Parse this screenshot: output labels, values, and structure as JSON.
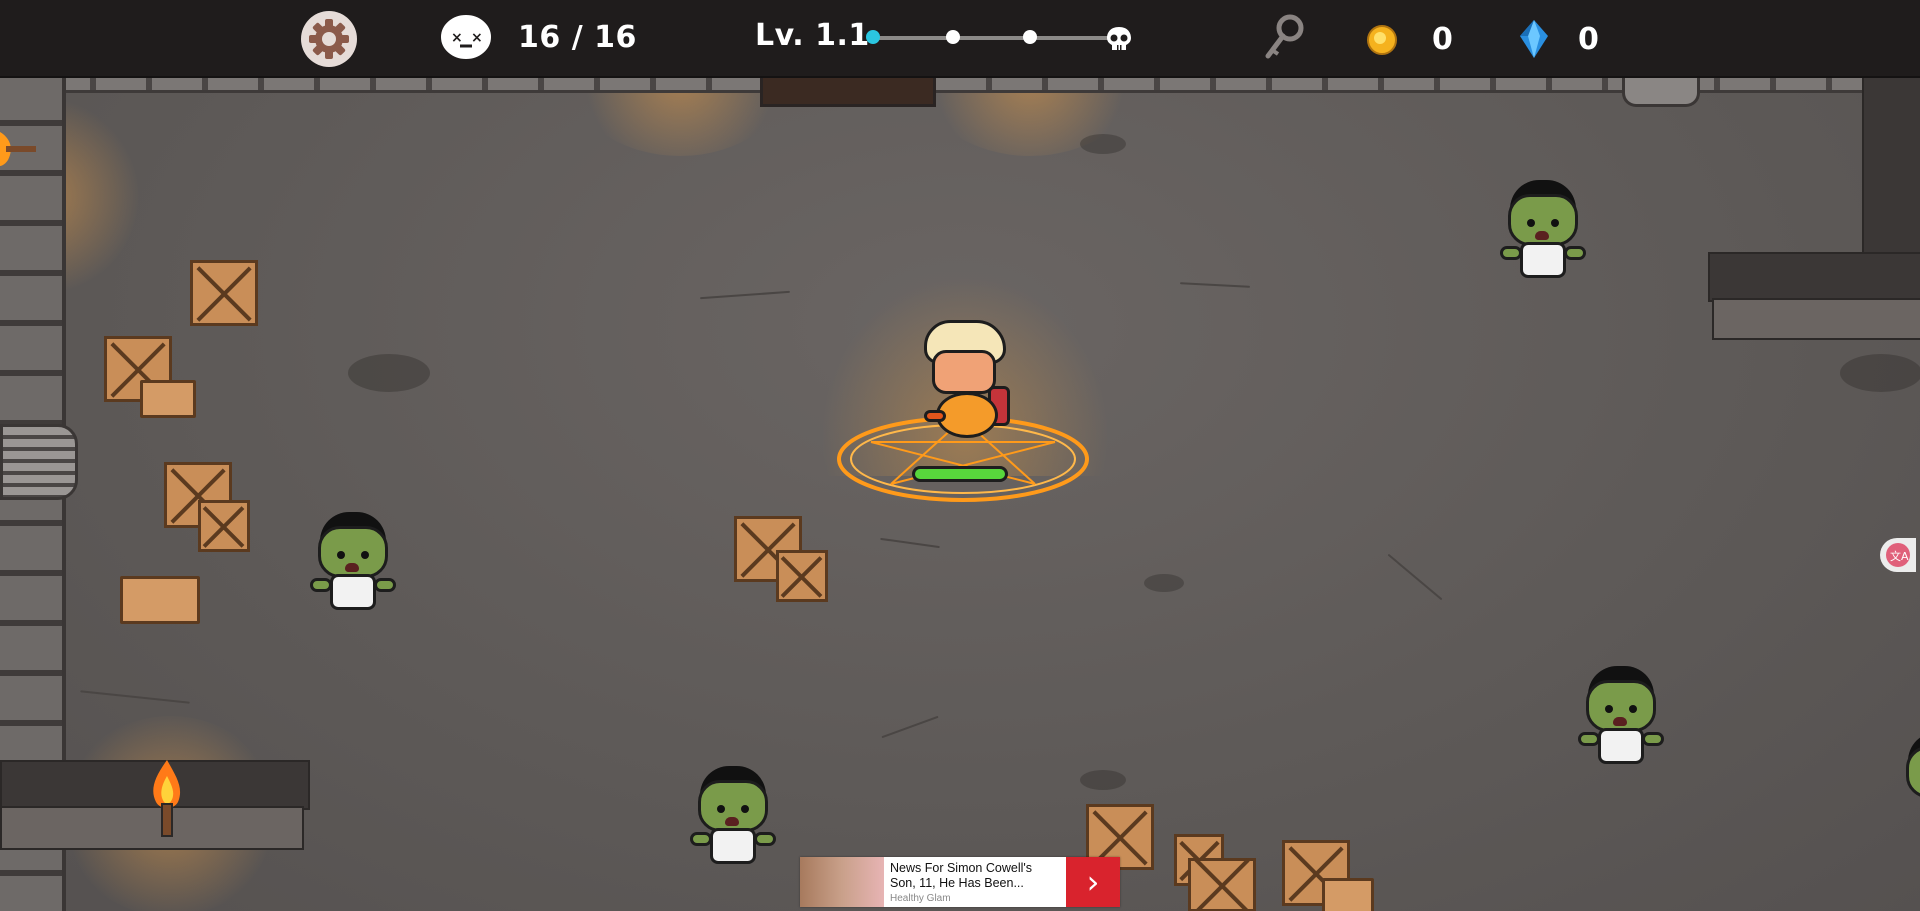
{
  "hud": {
    "settings_icon": "gear-icon",
    "kills_icon": "dead-face-icon",
    "kills_text": "16 / 16",
    "level_text": "Lv. 1.1",
    "level_progress": 0,
    "stages": [
      "stage-1",
      "stage-2",
      "stage-3",
      "boss"
    ],
    "key_icon": "key-icon",
    "coin_icon": "coin-icon",
    "coins": "0",
    "gem_icon": "diamond-icon",
    "gems": "0"
  },
  "colors": {
    "hud_bg": "#1f1c1c",
    "floor": "#5d5957",
    "progress_active": "#2bc6e0",
    "health": "#58d63c",
    "magic_circle": "#ff9a1a"
  },
  "player": {
    "health_fraction": 1.0
  },
  "ad": {
    "headline": "News For Simon Cowell's Son, 11, He Has Been...",
    "source": "Healthy Glam",
    "arrow": "›"
  }
}
